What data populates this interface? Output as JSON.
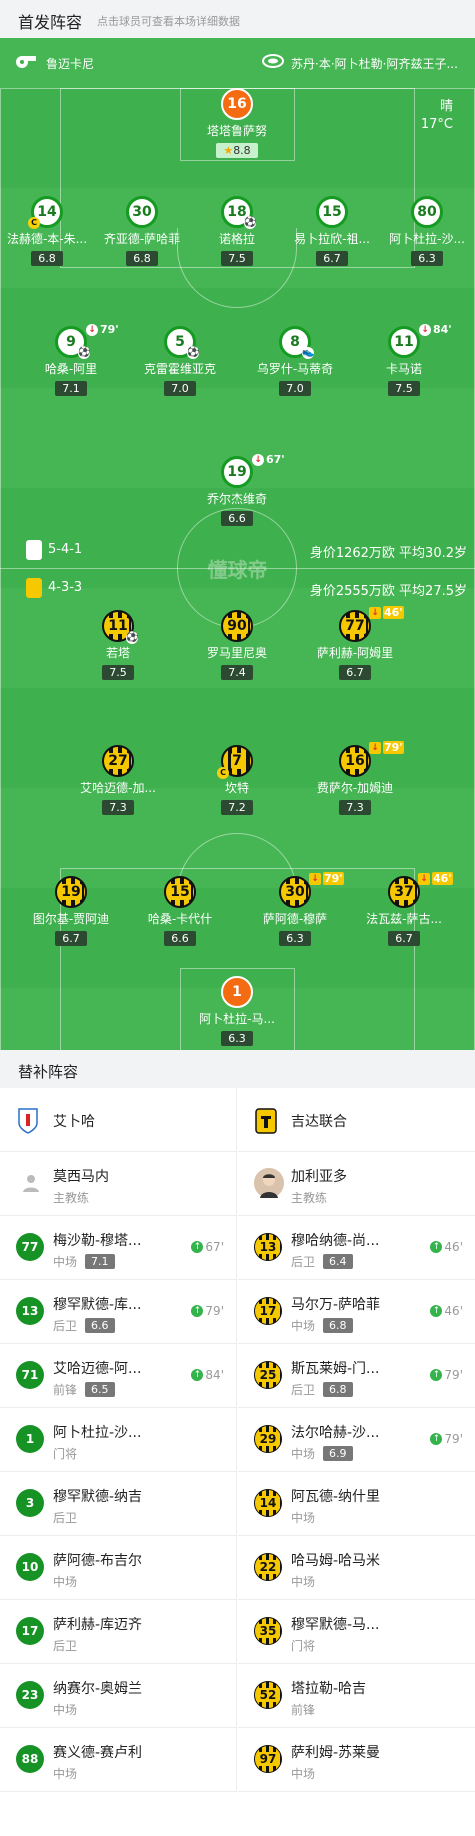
{
  "header": {
    "title": "首发阵容",
    "subtitle": "点击球员可查看本场详细数据"
  },
  "pitch": {
    "home_team": "鲁迈卡尼",
    "away_team": "苏丹·本·阿卜杜勒·阿齐兹王子...",
    "weather": "晴",
    "temperature": "17°C",
    "watermark": "懂球帝",
    "home_formation": "5-4-1",
    "home_value": "身价1262万欧 平均30.2岁",
    "away_formation": "4-3-3",
    "away_value": "身价2555万欧 平均27.5岁"
  },
  "home_players": [
    {
      "num": "16",
      "name": "塔塔鲁萨努",
      "rating": "8.8",
      "gk": true,
      "star": true
    },
    {
      "num": "14",
      "name": "法赫德-本-朱...",
      "rating": "6.8",
      "captain": true
    },
    {
      "num": "30",
      "name": "齐亚德-萨哈菲",
      "rating": "6.8"
    },
    {
      "num": "18",
      "name": "诺格拉",
      "rating": "7.5",
      "goal": true
    },
    {
      "num": "15",
      "name": "易卜拉欣-祖...",
      "rating": "6.7"
    },
    {
      "num": "80",
      "name": "阿卜杜拉-沙...",
      "rating": "6.3"
    },
    {
      "num": "9",
      "name": "哈桑-阿里",
      "rating": "7.1",
      "sub_min": "79'",
      "goal": true
    },
    {
      "num": "5",
      "name": "克雷霍维亚克",
      "rating": "7.0",
      "goal": true
    },
    {
      "num": "8",
      "name": "乌罗什-马蒂奇",
      "rating": "7.0",
      "assist": true
    },
    {
      "num": "11",
      "name": "卡马诺",
      "rating": "7.5",
      "sub_min": "84'"
    },
    {
      "num": "19",
      "name": "乔尔杰维奇",
      "rating": "6.6",
      "sub_min": "67'"
    }
  ],
  "away_players": [
    {
      "num": "11",
      "name": "若塔",
      "rating": "7.5",
      "goal": true
    },
    {
      "num": "90",
      "name": "罗马里尼奥",
      "rating": "7.4"
    },
    {
      "num": "77",
      "name": "萨利赫-阿姆里",
      "rating": "6.7",
      "sub_min": "46'"
    },
    {
      "num": "27",
      "name": "艾哈迈德-加...",
      "rating": "7.3"
    },
    {
      "num": "7",
      "name": "坎特",
      "rating": "7.2",
      "captain": true
    },
    {
      "num": "16",
      "name": "费萨尔-加姆迪",
      "rating": "7.3",
      "sub_min": "79'"
    },
    {
      "num": "19",
      "name": "图尔基-贾阿迪",
      "rating": "6.7"
    },
    {
      "num": "15",
      "name": "哈桑-卡代什",
      "rating": "6.6"
    },
    {
      "num": "30",
      "name": "萨阿德-穆萨",
      "rating": "6.3",
      "sub_min": "79'"
    },
    {
      "num": "37",
      "name": "法瓦兹-萨古...",
      "rating": "6.7",
      "sub_min": "46'"
    },
    {
      "num": "1",
      "name": "阿卜杜拉-马...",
      "rating": "6.3",
      "gk": true
    }
  ],
  "subs": {
    "title": "替补阵容",
    "home": {
      "team": "艾卜哈",
      "coach": {
        "name": "莫西马内",
        "role": "主教练"
      },
      "list": [
        {
          "num": "77",
          "name": "梅沙勒-穆塔...",
          "pos": "中场",
          "rating": "7.1",
          "in": "67'"
        },
        {
          "num": "13",
          "name": "穆罕默德-库...",
          "pos": "后卫",
          "rating": "6.6",
          "in": "79'"
        },
        {
          "num": "71",
          "name": "艾哈迈德-阿...",
          "pos": "前锋",
          "rating": "6.5",
          "in": "84'"
        },
        {
          "num": "1",
          "name": "阿卜杜拉-沙...",
          "pos": "门将"
        },
        {
          "num": "3",
          "name": "穆罕默德-纳吉",
          "pos": "后卫"
        },
        {
          "num": "10",
          "name": "萨阿德-布吉尔",
          "pos": "中场"
        },
        {
          "num": "17",
          "name": "萨利赫-库迈齐",
          "pos": "后卫"
        },
        {
          "num": "23",
          "name": "纳赛尔-奥姆兰",
          "pos": "中场"
        },
        {
          "num": "88",
          "name": "赛义德-赛卢利",
          "pos": "中场"
        }
      ]
    },
    "away": {
      "team": "吉达联合",
      "coach": {
        "name": "加利亚多",
        "role": "主教练"
      },
      "list": [
        {
          "num": "13",
          "name": "穆哈纳德-尚...",
          "pos": "后卫",
          "rating": "6.4",
          "in": "46'"
        },
        {
          "num": "17",
          "name": "马尔万-萨哈菲",
          "pos": "中场",
          "rating": "6.8",
          "in": "46'"
        },
        {
          "num": "25",
          "name": "斯瓦莱姆-门...",
          "pos": "后卫",
          "rating": "6.8",
          "in": "79'"
        },
        {
          "num": "29",
          "name": "法尔哈赫-沙...",
          "pos": "中场",
          "rating": "6.9",
          "in": "79'"
        },
        {
          "num": "14",
          "name": "阿瓦德-纳什里",
          "pos": "中场"
        },
        {
          "num": "22",
          "name": "哈马姆-哈马米",
          "pos": "中场"
        },
        {
          "num": "35",
          "name": "穆罕默德-马...",
          "pos": "门将"
        },
        {
          "num": "52",
          "name": "塔拉勒-哈吉",
          "pos": "前锋"
        },
        {
          "num": "97",
          "name": "萨利姆-苏莱曼",
          "pos": "中场"
        }
      ]
    }
  }
}
